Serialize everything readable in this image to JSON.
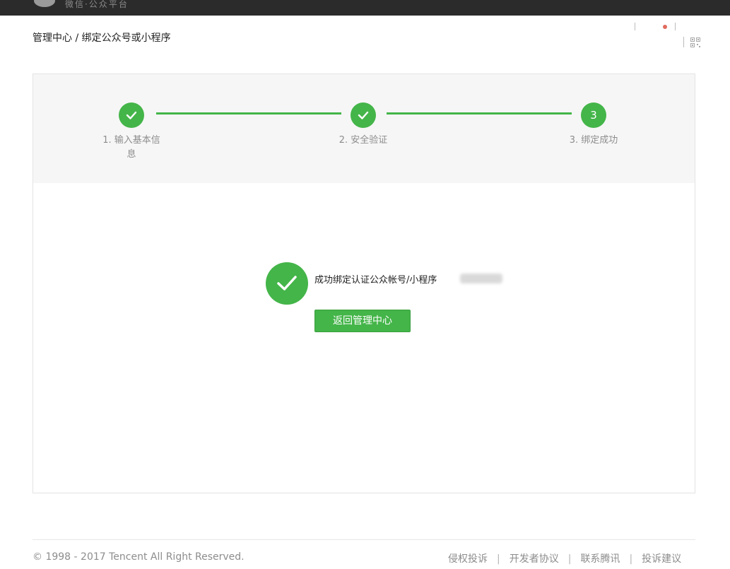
{
  "header": {
    "brand": "微信·公众平台"
  },
  "breadcrumb": {
    "text": "管理中心 / 绑定公众号或小程序"
  },
  "steps": [
    {
      "label_line1": "1. 输入基本信",
      "label_line2": "息",
      "status": "done"
    },
    {
      "label_line1": "2. 安全验证",
      "label_line2": "",
      "status": "done"
    },
    {
      "number": "3",
      "label_line1": "3. 绑定成功",
      "label_line2": "",
      "status": "current"
    }
  ],
  "result": {
    "message": "成功绑定认证公众帐号/小程序",
    "button_label": "返回管理中心"
  },
  "footer": {
    "copyright": "© 1998 - 2017 Tencent All Right Reserved.",
    "links": [
      "侵权投诉",
      "开发者协议",
      "联系腾讯",
      "投诉建议"
    ]
  },
  "colors": {
    "accent": "#44b549",
    "topbar": "#2b2b2b",
    "notification_dot": "#e06a5e"
  },
  "icons": {
    "step_done": "check-icon",
    "success": "check-circle-icon",
    "qr": "qr-code-icon"
  }
}
